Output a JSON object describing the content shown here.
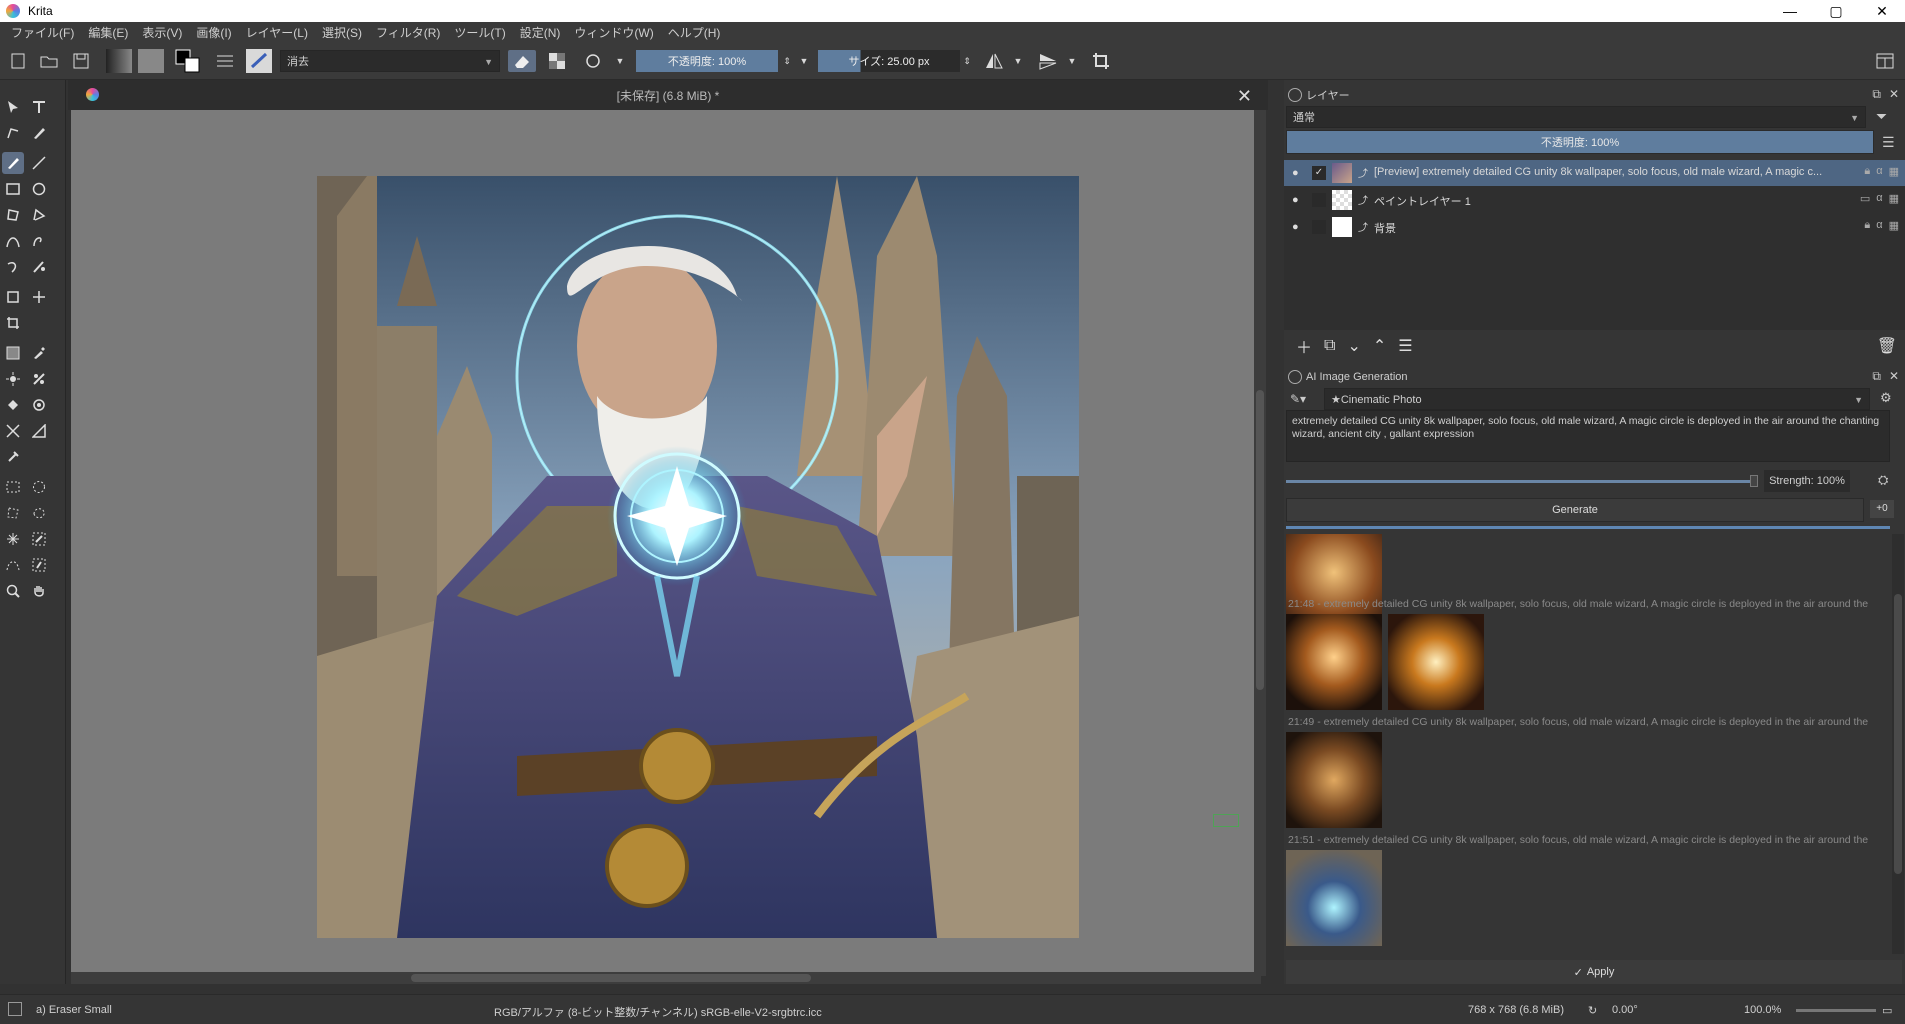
{
  "app": {
    "title": "Krita"
  },
  "window": {
    "minimize": "—",
    "maximize": "▢",
    "close": "✕"
  },
  "menu": [
    "ファイル(F)",
    "編集(E)",
    "表示(V)",
    "画像(I)",
    "レイヤー(L)",
    "選択(S)",
    "フィルタ(R)",
    "ツール(T)",
    "設定(N)",
    "ウィンドウ(W)",
    "ヘルプ(H)"
  ],
  "toolbar": {
    "blend_mode": "消去",
    "opacity": "不透明度: 100%",
    "size": "サイズ: 25.00 px"
  },
  "document": {
    "title": "[未保存]  (6.8 MiB) *",
    "close": "✕"
  },
  "layers_panel": {
    "title": "レイヤー",
    "blend_mode": "通常",
    "opacity": "不透明度: 100%",
    "layers": [
      {
        "name": "[Preview] extremely detailed CG unity 8k wallpaper, solo focus, old male wizard,  A magic c...",
        "checked": "✓"
      },
      {
        "name": "ペイントレイヤー 1",
        "checked": ""
      },
      {
        "name": "背景",
        "checked": ""
      }
    ]
  },
  "ai_panel": {
    "title": "AI Image Generation",
    "style": "★Cinematic Photo",
    "prompt": "extremely detailed CG unity 8k wallpaper, solo focus, old male wizard,  A magic circle is deployed in the air around the chanting wizard, ancient city , gallant expression",
    "strength": "Strength: 100%",
    "generate": "Generate",
    "gen_side": "+0",
    "history": [
      "21:48 - extremely detailed CG unity 8k wallpaper, solo focus, old male wizard,  A magic circle is deployed in the air around the",
      "21:49 - extremely detailed CG unity 8k wallpaper, solo focus, old male wizard,  A magic circle is deployed in the air around the",
      "21:51 - extremely detailed CG unity 8k wallpaper, solo focus, old male wizard,  A magic circle is deployed in the air around the"
    ],
    "apply": "Apply"
  },
  "status": {
    "brush": "a) Eraser Small",
    "color_space": "RGB/アルファ (8-ビット整数/チャンネル)  sRGB-elle-V2-srgbtrc.icc",
    "dimensions": "768 x 768 (6.8 MiB)",
    "rotation": "0.00°",
    "zoom": "100.0%"
  },
  "colors": {
    "accent": "#5f7d9e",
    "selected_layer": "#4e6683",
    "magic_glow": "#7fe6ff"
  }
}
